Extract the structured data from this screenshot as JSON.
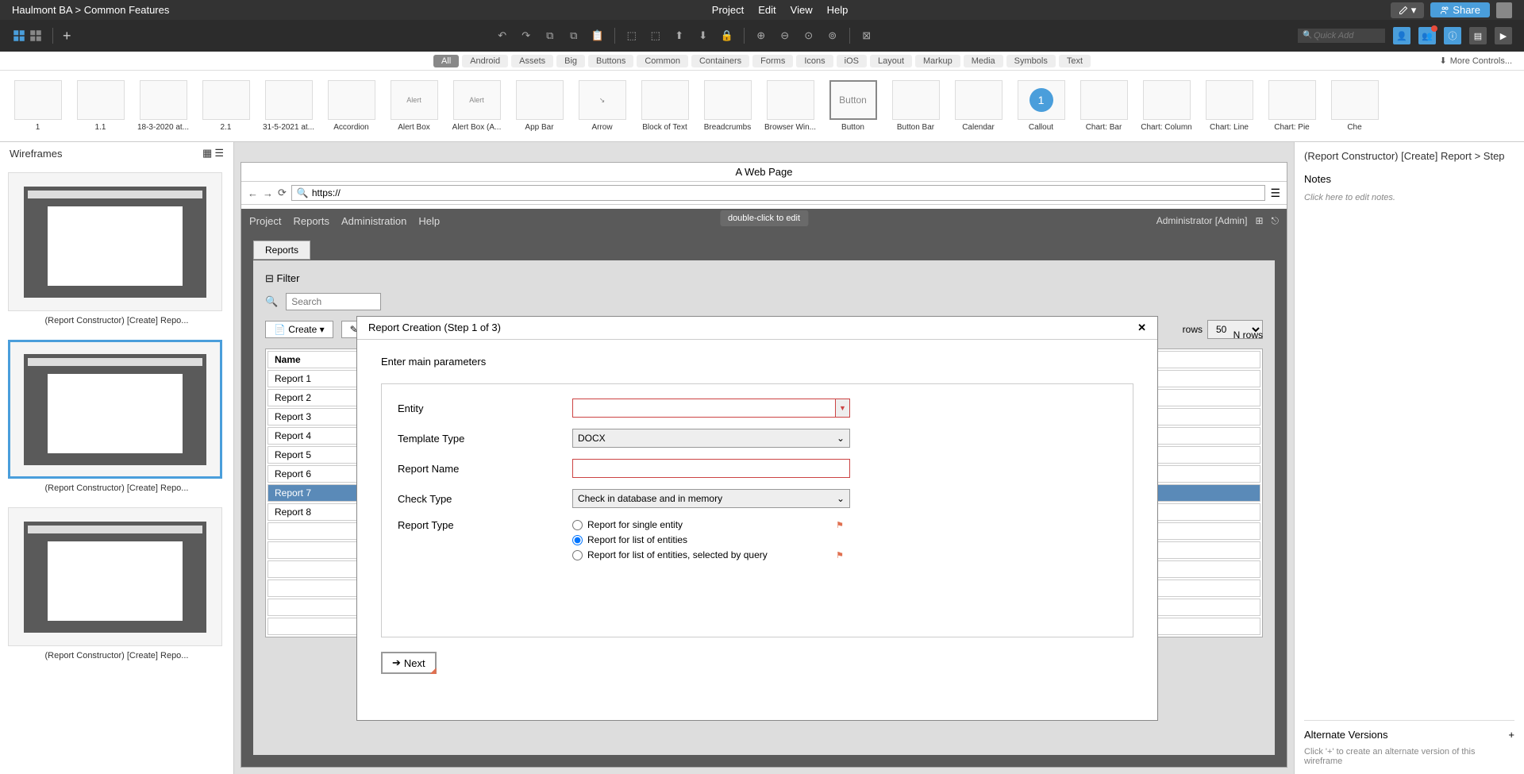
{
  "breadcrumb": {
    "project": "Haulmont BA",
    "sep": ">",
    "page": "Common Features"
  },
  "topmenu": {
    "project": "Project",
    "edit": "Edit",
    "view": "View",
    "help": "Help"
  },
  "topbuttons": {
    "edit": "",
    "share": "Share"
  },
  "quick_add_placeholder": "Quick Add",
  "filters": [
    "All",
    "Android",
    "Assets",
    "Big",
    "Buttons",
    "Common",
    "Containers",
    "Forms",
    "Icons",
    "iOS",
    "Layout",
    "Markup",
    "Media",
    "Symbols",
    "Text"
  ],
  "more_controls": "More Controls...",
  "lib": [
    {
      "label": "1"
    },
    {
      "label": "1.1"
    },
    {
      "label": "18-3-2020 at..."
    },
    {
      "label": "2.1"
    },
    {
      "label": "31-5-2021 at..."
    },
    {
      "label": "Accordion"
    },
    {
      "label": "Alert Box"
    },
    {
      "label": "Alert Box (A..."
    },
    {
      "label": "App Bar"
    },
    {
      "label": "Arrow"
    },
    {
      "label": "Block of Text"
    },
    {
      "label": "Breadcrumbs"
    },
    {
      "label": "Browser Win..."
    },
    {
      "label": "Button",
      "thumb": "Button"
    },
    {
      "label": "Button Bar"
    },
    {
      "label": "Calendar"
    },
    {
      "label": "Callout",
      "thumb": "1"
    },
    {
      "label": "Chart: Bar"
    },
    {
      "label": "Chart: Column"
    },
    {
      "label": "Chart: Line"
    },
    {
      "label": "Chart: Pie"
    },
    {
      "label": "Che"
    }
  ],
  "left_panel": {
    "title": "Wireframes",
    "items": [
      {
        "caption": "(Report Constructor) [Create] Repo..."
      },
      {
        "caption": "(Report Constructor) [Create] Repo...",
        "selected": true
      },
      {
        "caption": "(Report Constructor) [Create] Repo..."
      }
    ]
  },
  "right_panel": {
    "title": "(Report Constructor) [Create] Report > Step",
    "notes_label": "Notes",
    "notes_hint": "Click here to edit notes.",
    "alt_label": "Alternate Versions",
    "alt_hint": "Click '+' to create an alternate version of this wireframe"
  },
  "browser": {
    "title": "A Web Page",
    "url": "https://"
  },
  "app": {
    "menu": [
      "Project",
      "Reports",
      "Administration",
      "Help"
    ],
    "user": "Administrator [Admin]",
    "tooltip": "double-click to edit",
    "tab": "Reports",
    "filter": "Filter",
    "search_placeholder": "Search",
    "create": "Create",
    "rows_label": "rows",
    "rows_value": "50",
    "nrows": "N rows",
    "table_header": "Name",
    "rows": [
      "Report 1",
      "Report 2",
      "Report 3",
      "Report 4",
      "Report 5",
      "Report 6",
      "Report 7",
      "Report 8"
    ],
    "selected_row": 6
  },
  "modal": {
    "title": "Report Creation (Step 1 of 3)",
    "subtitle": "Enter main parameters",
    "labels": {
      "entity": "Entity",
      "template": "Template Type",
      "name": "Report Name",
      "check": "Check Type",
      "report_type": "Report Type"
    },
    "template_value": "DOCX",
    "check_value": "Check in database and in memory",
    "radios": [
      "Report for single entity",
      "Report for list of entities",
      "Report for list of entities, selected by query"
    ],
    "radio_selected": 1,
    "next": "Next"
  }
}
